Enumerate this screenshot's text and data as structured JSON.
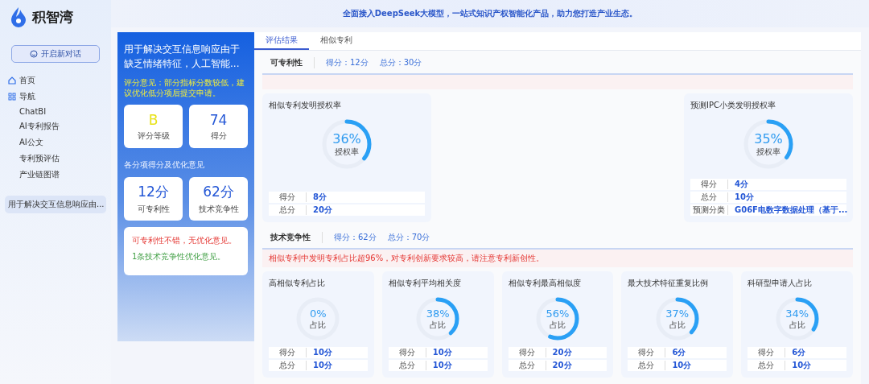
{
  "brand": {
    "name": "积智湾"
  },
  "banner": {
    "text": "全面接入DeepSeek大模型，一站式知识产权智能化产品，助力您打造产业生态。"
  },
  "sidebar": {
    "new_chat": "开启新对话",
    "nav": [
      {
        "label": "首页",
        "kind": "home"
      },
      {
        "label": "导航",
        "kind": "grid",
        "children": [
          {
            "label": "ChatBI"
          },
          {
            "label": "AI专利报告"
          },
          {
            "label": "AI公文"
          },
          {
            "label": "专利预评估"
          },
          {
            "label": "产业链图谱"
          }
        ]
      }
    ],
    "history": [
      {
        "label": "用于解决交互信息响应由...",
        "selected": true
      }
    ]
  },
  "summary": {
    "title": "用于解决交互信息响应由于缺乏情绪特征，人工智能...",
    "comment": "评分意见：部分指标分数较低，建议优化低分项后提交申请。",
    "stats": [
      {
        "kind": "grade",
        "value": "B",
        "label": "评分等级"
      },
      {
        "kind": "score",
        "value": "74",
        "label": "得分"
      }
    ],
    "section_label": "各分项得分及优化意见",
    "subs": [
      {
        "value": "12分",
        "label": "可专利性"
      },
      {
        "value": "62分",
        "label": "技术竞争性"
      }
    ],
    "notes": [
      {
        "text": "可专利性不错，无优化意见。",
        "kind": "patentability"
      },
      {
        "text": "1条技术竞争性优化意见。",
        "kind": "competitiveness"
      }
    ]
  },
  "tabs": [
    {
      "label": "评估结果",
      "selected": true
    },
    {
      "label": "相似专利",
      "selected": false
    }
  ],
  "sections": [
    {
      "name": "可专利性",
      "score": "得分：12分",
      "total": "总分：30分",
      "cards": [
        {
          "title": "相似专利发明授权率",
          "percent": "36%",
          "caption": "授权率",
          "level": 0.36,
          "rows": [
            {
              "label": "得分",
              "value": "8分"
            },
            {
              "label": "总分",
              "value": "20分"
            }
          ]
        },
        {
          "title": "预测IPC小类发明授权率",
          "percent": "35%",
          "caption": "授权率",
          "level": 0.35,
          "rows": [
            {
              "label": "得分",
              "value": "4分"
            },
            {
              "label": "总分",
              "value": "10分"
            },
            {
              "label": "预测分类",
              "value": "G06F电数字数据处理（基于..."
            }
          ]
        }
      ]
    },
    {
      "name": "技术竞争性",
      "score": "得分：62分",
      "total": "总分：70分",
      "alert": "相似专利中发明专利占比超96%，对专利创新要求较高，请注意专利新创性。",
      "cards": [
        {
          "title": "高相似专利占比",
          "percent": "0%",
          "caption": "占比",
          "rows": [
            {
              "label": "得分",
              "value": "10分"
            },
            {
              "label": "总分",
              "value": "10分"
            }
          ]
        },
        {
          "title": "相似专利平均相关度",
          "percent": "38%",
          "caption": "占比",
          "level": 0.38,
          "rows": [
            {
              "label": "得分",
              "value": "10分"
            },
            {
              "label": "总分",
              "value": "10分"
            }
          ]
        },
        {
          "title": "相似专利最高相似度",
          "percent": "56%",
          "caption": "占比",
          "level": 0.56,
          "rows": [
            {
              "label": "得分",
              "value": "20分"
            },
            {
              "label": "总分",
              "value": "20分"
            }
          ]
        },
        {
          "title": "最大技术特征重复比例",
          "percent": "37%",
          "caption": "占比",
          "level": 0.37,
          "rows": [
            {
              "label": "得分",
              "value": "6分"
            },
            {
              "label": "总分",
              "value": "10分"
            }
          ]
        },
        {
          "title": "科研型申请人占比",
          "percent": "34%",
          "caption": "占比",
          "level": 0.34,
          "rows": [
            {
              "label": "得分",
              "value": "6分"
            },
            {
              "label": "总分",
              "value": "10分"
            }
          ]
        }
      ]
    }
  ]
}
